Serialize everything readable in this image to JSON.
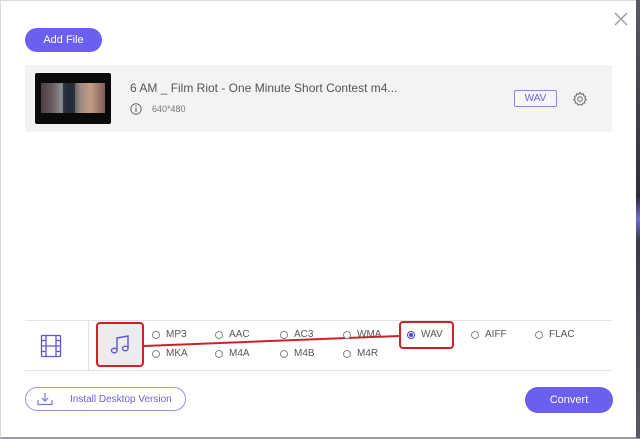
{
  "toolbar": {
    "add_file_label": "Add File"
  },
  "file": {
    "name": "6 AM _ Film Riot - One Minute Short Contest m4...",
    "resolution": "640*480",
    "output_format": "WAV"
  },
  "formats": {
    "selected": "WAV",
    "row1": [
      "MP3",
      "AAC",
      "AC3",
      "WMA",
      "WAV",
      "AIFF",
      "FLAC"
    ],
    "row2": [
      "MKA",
      "M4A",
      "M4B",
      "M4R"
    ]
  },
  "footer": {
    "install_label": "Install Desktop Version",
    "convert_label": "Convert"
  },
  "colors": {
    "accent": "#6b5ff2",
    "highlight": "#d0202a"
  },
  "icons": [
    "close-icon",
    "info-icon",
    "gear-icon",
    "film-icon",
    "music-note-icon",
    "download-icon"
  ]
}
